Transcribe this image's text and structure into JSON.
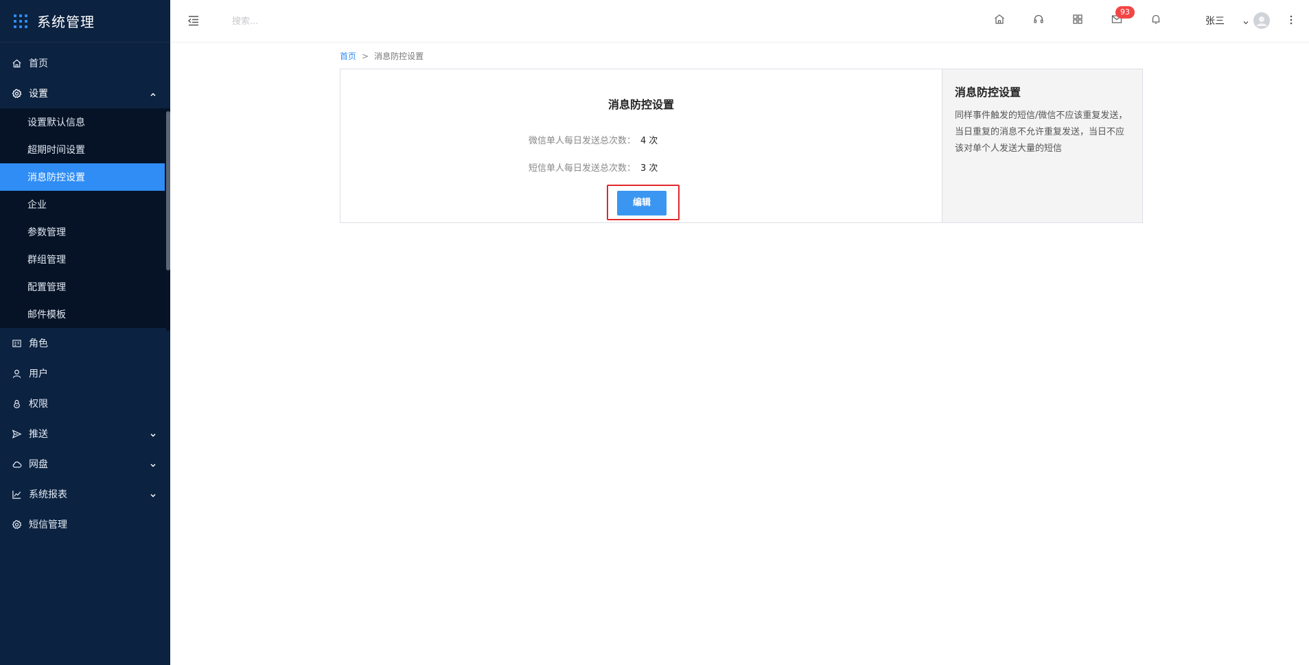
{
  "app": {
    "title": "系统管理"
  },
  "header": {
    "search_placeholder": "搜索...",
    "mail_badge": "93",
    "username": "张三"
  },
  "sidebar": {
    "items": [
      {
        "label": "首页",
        "icon": "home-icon"
      },
      {
        "label": "设置",
        "icon": "gear-icon",
        "expanded": true
      },
      {
        "label": "角色",
        "icon": "role-icon"
      },
      {
        "label": "用户",
        "icon": "user-icon"
      },
      {
        "label": "权限",
        "icon": "lock-icon"
      },
      {
        "label": "推送",
        "icon": "send-icon"
      },
      {
        "label": "网盘",
        "icon": "cloud-icon"
      },
      {
        "label": "系统报表",
        "icon": "chart-icon"
      },
      {
        "label": "短信管理",
        "icon": "gear-icon"
      }
    ],
    "settings_children": [
      {
        "label": "设置默认信息"
      },
      {
        "label": "超期时间设置"
      },
      {
        "label": "消息防控设置",
        "active": true
      },
      {
        "label": "企业"
      },
      {
        "label": "参数管理"
      },
      {
        "label": "群组管理"
      },
      {
        "label": "配置管理"
      },
      {
        "label": "邮件模板"
      }
    ]
  },
  "breadcrumb": {
    "home": "首页",
    "separator": ">",
    "current": "消息防控设置"
  },
  "card": {
    "title": "消息防控设置",
    "wechat_label": "微信单人每日发送总次数：",
    "wechat_value": "4 次",
    "sms_label": "短信单人每日发送总次数：",
    "sms_value": "3 次",
    "edit_label": "编辑"
  },
  "side": {
    "title": "消息防控设置",
    "text": "同样事件触发的短信/微信不应该重复发送，当日重复的消息不允许重复发送，当日不应该对单个人发送大量的短信"
  },
  "colors": {
    "sidebar_bg": "#0b2240",
    "submenu_bg": "#061327",
    "accent": "#2f8df5",
    "badge": "#f24646",
    "highlight_outline": "#e3262a"
  }
}
